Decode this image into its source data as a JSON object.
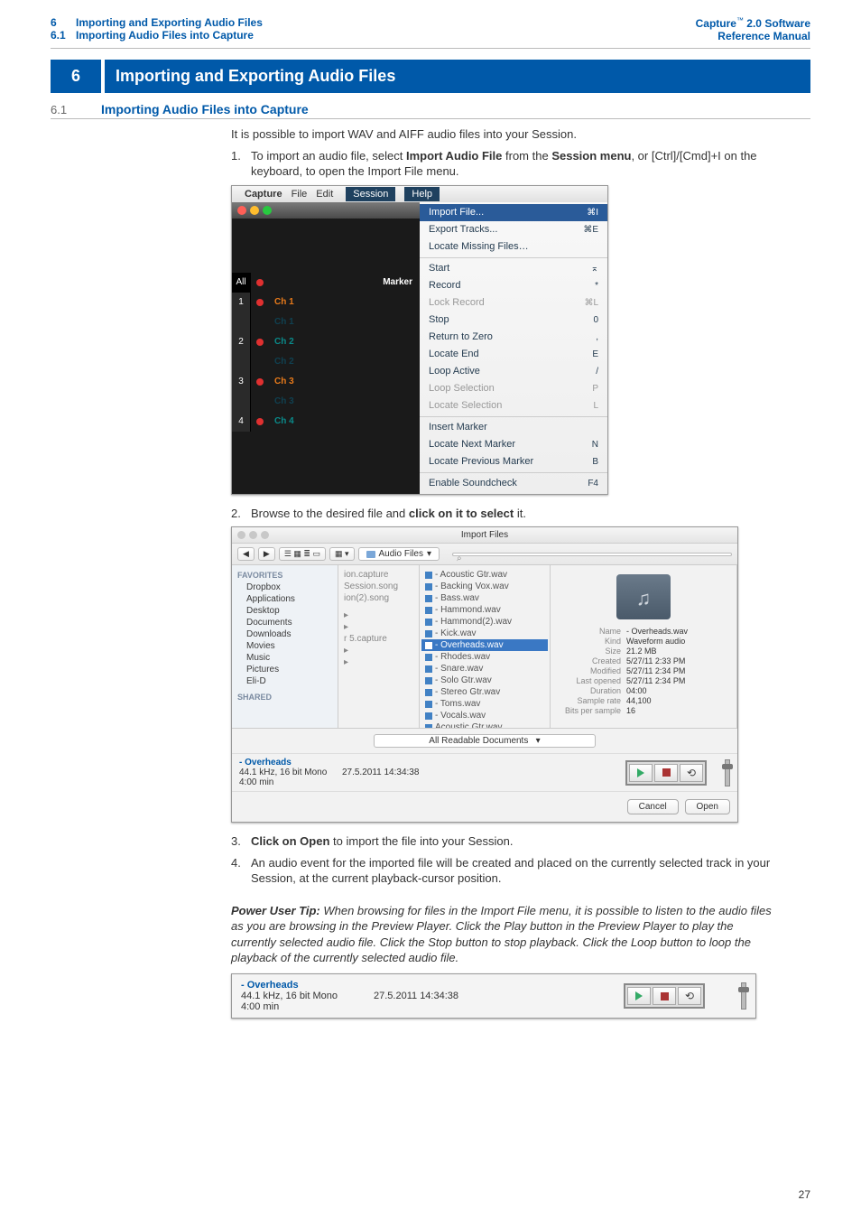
{
  "header": {
    "left": {
      "chapterNum": "6",
      "chapterTitle": "Importing and Exporting Audio Files",
      "sectionNum": "6.1",
      "sectionTitle": "Importing Audio Files into Capture"
    },
    "right": {
      "line1a": "Capture",
      "line1b": " 2.0 Software",
      "line2": "Reference Manual"
    }
  },
  "chapter": {
    "num": "6",
    "title": "Importing and Exporting Audio Files"
  },
  "section": {
    "num": "6.1",
    "title": "Importing Audio Files into Capture"
  },
  "intro": "It is possible to import WAV and AIFF audio files into your Session.",
  "step1": {
    "num": "1.",
    "textA": "To import an audio file, select ",
    "bold1": "Import Audio File",
    "textB": " from the ",
    "bold2": "Session menu",
    "textC": ", or [Ctrl]/[Cmd]+I on the keyboard, to open the Import File menu."
  },
  "menubar": {
    "capture": "Capture",
    "file": "File",
    "edit": "Edit",
    "session": "Session",
    "help": "Help"
  },
  "tracks": {
    "all": "All",
    "marker": "Marker",
    "r1n": "1",
    "r1a": "Ch 1",
    "r1b": "Ch 1",
    "r2n": "2",
    "r2a": "Ch 2",
    "r2b": "Ch 2",
    "r3n": "3",
    "r3a": "Ch 3",
    "r3b": "Ch 3",
    "r4n": "4",
    "r4a": "Ch 4"
  },
  "menu": {
    "importFile": "Import File...",
    "importFileSc": "⌘I",
    "exportTracks": "Export Tracks...",
    "exportTracksSc": "⌘E",
    "locateMissing": "Locate Missing Files…",
    "start": "Start",
    "startSc": "⌅",
    "record": "Record",
    "recordSc": "*",
    "lockRecord": "Lock Record",
    "lockRecordSc": "⌘L",
    "stop": "Stop",
    "stopSc": "0",
    "returnZero": "Return to Zero",
    "returnZeroSc": ",",
    "locateEnd": "Locate End",
    "locateEndSc": "E",
    "loopActive": "Loop Active",
    "loopActiveSc": "/",
    "loopSelection": "Loop Selection",
    "loopSelectionSc": "P",
    "locateSelection": "Locate Selection",
    "locateSelectionSc": "L",
    "insertMarker": "Insert Marker",
    "locateNext": "Locate Next Marker",
    "locateNextSc": "N",
    "locatePrev": "Locate Previous Marker",
    "locatePrevSc": "B",
    "enableSound": "Enable Soundcheck",
    "enableSoundSc": "F4"
  },
  "step2": {
    "num": "2.",
    "textA": "Browse to the desired file and ",
    "bold": "click on it to select",
    "textB": " it."
  },
  "dialog": {
    "title": "Import Files",
    "pathLabel": "Audio Files",
    "favorites": "FAVORITES",
    "sidebar": {
      "dropbox": "Dropbox",
      "applications": "Applications",
      "desktop": "Desktop",
      "documents": "Documents",
      "downloads": "Downloads",
      "movies": "Movies",
      "music": "Music",
      "pictures": "Pictures",
      "elid": "Eli-D"
    },
    "shared": "SHARED",
    "col2": {
      "a": "ion.capture",
      "b": "Session.song",
      "c": "ion(2).song",
      "d": "r 5.capture"
    },
    "col3": {
      "f1": "- Acoustic Gtr.wav",
      "f2": "- Backing Vox.wav",
      "f3": "- Bass.wav",
      "f4": "- Hammond.wav",
      "f5": "- Hammond(2).wav",
      "f6": "- Kick.wav",
      "f7": "- Overheads.wav",
      "f8": "- Rhodes.wav",
      "f9": "- Snare.wav",
      "f10": "- Solo Gtr.wav",
      "f11": "- Stereo Gtr.wav",
      "f12": "- Toms.wav",
      "f13": "- Vocals.wav",
      "f14": "Acoustic Gtr.wav"
    },
    "meta": {
      "nameK": "Name",
      "nameV": "- Overheads.wav",
      "kindK": "Kind",
      "kindV": "Waveform audio",
      "sizeK": "Size",
      "sizeV": "21.2 MB",
      "createdK": "Created",
      "createdV": "5/27/11 2:33 PM",
      "modifiedK": "Modified",
      "modifiedV": "5/27/11 2:34 PM",
      "lastK": "Last opened",
      "lastV": "5/27/11 2:34 PM",
      "durK": "Duration",
      "durV": "04:00",
      "srK": "Sample rate",
      "srV": "44,100",
      "bpsK": "Bits per sample",
      "bpsV": "16"
    },
    "filter": "All Readable Documents",
    "preview": {
      "title": "- Overheads",
      "line2": "44.1 kHz, 16 bit Mono",
      "line3": "4:00 min",
      "ts": "27.5.2011 14:34:38"
    },
    "cancel": "Cancel",
    "open": "Open"
  },
  "step3": {
    "num": "3.",
    "bold": "Click on Open",
    "text": " to import the file into your Session."
  },
  "step4": {
    "num": "4.",
    "text": "An audio event for the imported file will be created and placed on the currently selected track in your Session, at the current playback-cursor position."
  },
  "tip": {
    "label": "Power User Tip:",
    "text": " When browsing for files in the Import File menu, it is possible to listen to the audio files as you are browsing in the Preview Player. Click the Play button in the Preview Player to play the currently selected audio file. Click the Stop button to stop playback. Click the Loop button to loop the playback of the currently selected audio file."
  },
  "previewStrip": {
    "title": "- Overheads",
    "line2": "44.1 kHz, 16 bit Mono",
    "line3": "4:00 min",
    "ts": "27.5.2011 14:34:38"
  },
  "pageNum": "27"
}
